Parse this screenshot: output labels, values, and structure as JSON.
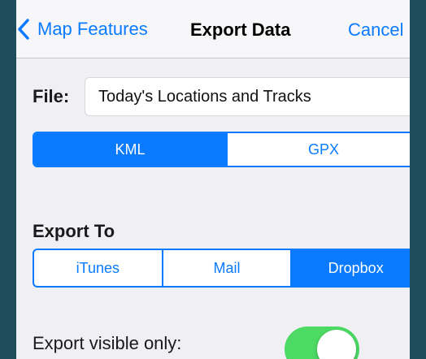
{
  "navbar": {
    "back_label": "Map Features",
    "title": "Export Data",
    "cancel_label": "Cancel"
  },
  "file": {
    "label": "File:",
    "value": "Today's Locations and Tracks"
  },
  "format": {
    "options": [
      "KML",
      "GPX"
    ],
    "selected": "KML"
  },
  "export_to": {
    "heading": "Export To",
    "options": [
      "iTunes",
      "Mail",
      "Dropbox"
    ],
    "selected": "Dropbox"
  },
  "visible_only": {
    "label": "Export visible only:",
    "on": true
  },
  "colors": {
    "accent": "#0a7aff",
    "toggle_on": "#4cd964",
    "background": "#efeff4",
    "outer_background": "#1e4d5c"
  },
  "icons": {
    "back": "chevron-left-icon"
  }
}
